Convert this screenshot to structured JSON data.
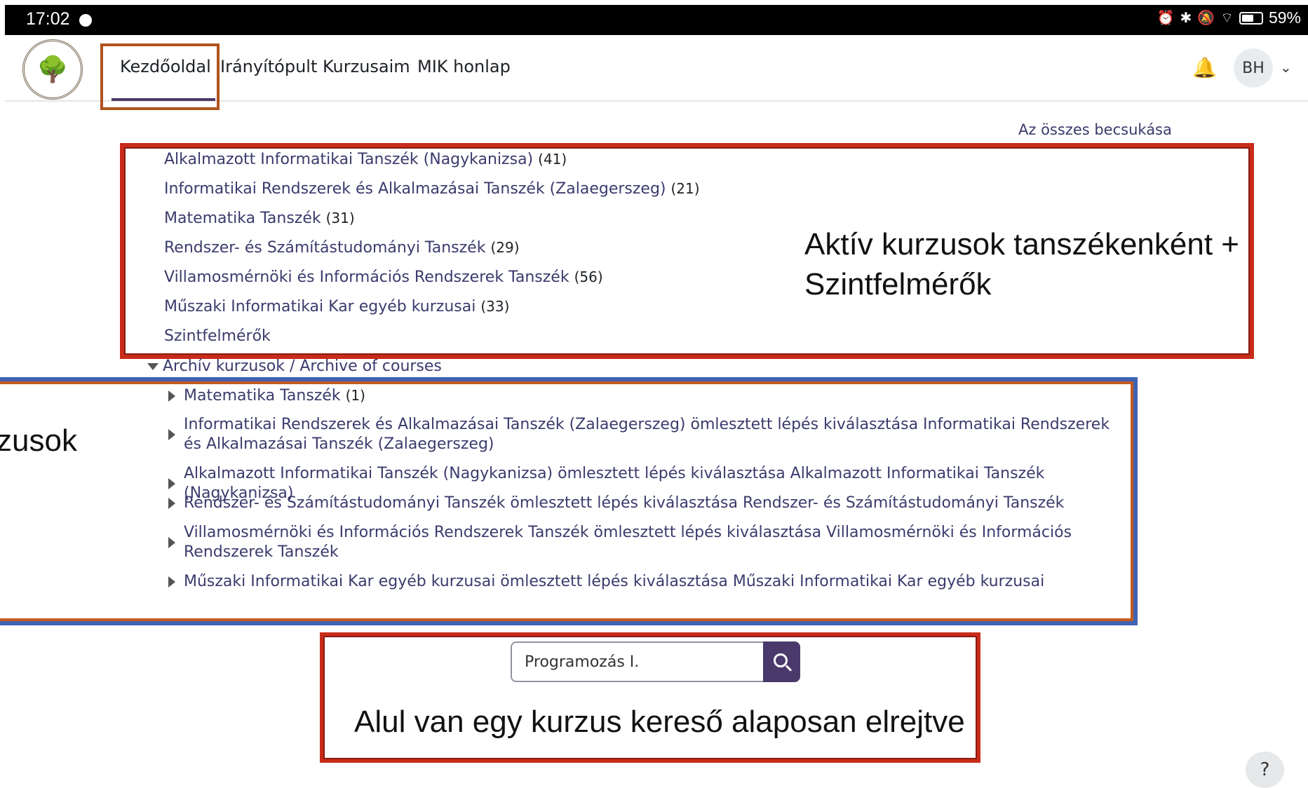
{
  "status_bar": {
    "time": "17:02",
    "battery": "59%",
    "icons": [
      "messenger-icon",
      "alarm-icon",
      "bluetooth-icon",
      "mute-icon",
      "wifi-icon",
      "battery-icon"
    ]
  },
  "nav": {
    "items": [
      {
        "label": "Kezdőoldal",
        "active": true
      },
      {
        "label": "Irányítópult"
      },
      {
        "label": "Kurzusaim"
      },
      {
        "label": "MIK honlap"
      }
    ],
    "avatar_initials": "BH"
  },
  "collapse_all": "Az összes becsukása",
  "active_categories": [
    {
      "name": "Alkalmazott Informatikai Tanszék (Nagykanizsa)",
      "count": "(41)"
    },
    {
      "name": "Informatikai Rendszerek és Alkalmazásai Tanszék (Zalaegerszeg)",
      "count": "(21)"
    },
    {
      "name": "Matematika Tanszék",
      "count": "(31)"
    },
    {
      "name": "Rendszer- és Számítástudományi Tanszék",
      "count": "(29)"
    },
    {
      "name": "Villamosmérnöki és Információs Rendszerek Tanszék",
      "count": "(56)"
    },
    {
      "name": "Műszaki Informatikai Kar egyéb kurzusai",
      "count": "(33)"
    },
    {
      "name": "Szintfelmérők",
      "count": ""
    }
  ],
  "archive": {
    "heading": "Archív kurzusok / Archive of courses",
    "items": [
      {
        "text": "Matematika Tanszék",
        "count": "(1)"
      },
      {
        "text": "Informatikai Rendszerek és Alkalmazásai Tanszék (Zalaegerszeg) ömlesztett lépés kiválasztása Informatikai Rendszerek és Alkalmazásai Tanszék (Zalaegerszeg)",
        "count": ""
      },
      {
        "text": "Alkalmazott Informatikai Tanszék (Nagykanizsa) ömlesztett lépés kiválasztása Alkalmazott Informatikai Tanszék (Nagykanizsa)",
        "count": ""
      },
      {
        "text": "Rendszer- és Számítástudományi Tanszék ömlesztett lépés kiválasztása Rendszer- és Számítástudományi Tanszék",
        "count": ""
      },
      {
        "text": "Villamosmérnöki és Információs Rendszerek Tanszék ömlesztett lépés kiválasztása Villamosmérnöki és Információs Rendszerek Tanszék",
        "count": ""
      },
      {
        "text": "Műszaki Informatikai Kar egyéb kurzusai ömlesztett lépés kiválasztása Műszaki Informatikai Kar egyéb kurzusai",
        "count": ""
      }
    ]
  },
  "annotations": {
    "active": "Aktív kurzusok tanszékenként + Szintfelmérők",
    "archive": "zusok",
    "search": "Alul van egy kurzus kereső alaposan elrejtve"
  },
  "search": {
    "value": "Programozás I."
  },
  "help_label": "?",
  "colors": {
    "accent": "#4a3a6b",
    "link": "#3b3b6d",
    "annotation_red": "#c82b1a",
    "annotation_blue": "#3f63b2",
    "annotation_orange": "#b0531f"
  }
}
